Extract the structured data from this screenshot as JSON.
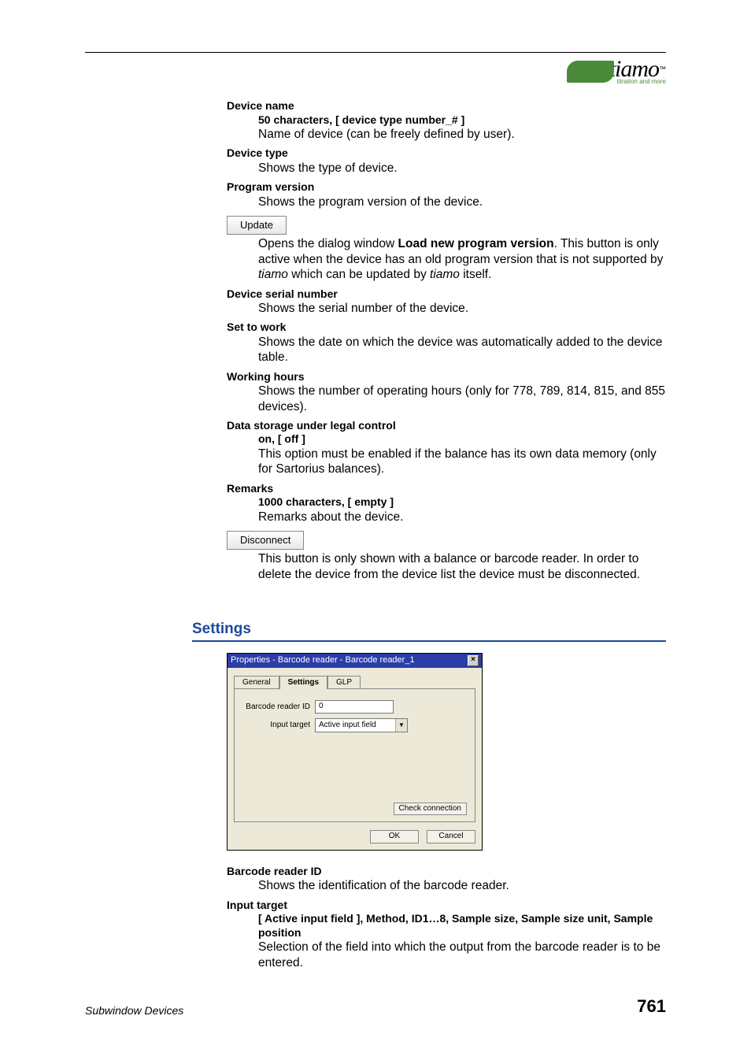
{
  "brand": {
    "name": "tiamo",
    "tm": "™",
    "sub": "titration and more"
  },
  "defs": {
    "device_name": {
      "term": "Device name",
      "sub": "50 characters, [ device type number_# ]",
      "body": "Name of device (can be freely defined by user)."
    },
    "device_type": {
      "term": "Device type",
      "body": "Shows the type of device."
    },
    "program_version": {
      "term": "Program version",
      "body": "Shows the program version of the device."
    },
    "update_btn": "Update",
    "update_body_1": "Opens the dialog window ",
    "update_body_bold": "Load new program version",
    "update_body_2": ". This button is only active when the device has an old program version that is not supported by ",
    "update_body_ital1": "tiamo",
    "update_body_3": " which can be updated by ",
    "update_body_ital2": "tiamo",
    "update_body_4": " itself.",
    "serial": {
      "term": "Device serial number",
      "body": "Shows the serial number of the device."
    },
    "set_to_work": {
      "term": "Set to work",
      "body": "Shows the date on which the device was automatically added to the device table."
    },
    "working_hours": {
      "term": "Working hours",
      "body": "Shows the number of operating hours (only for 778, 789, 814, 815, and 855 devices)."
    },
    "data_storage": {
      "term": "Data storage under legal control",
      "sub": "on, [ off ]",
      "body": "This option must be enabled if the balance has its own data memory (only for Sartorius balances)."
    },
    "remarks": {
      "term": "Remarks",
      "sub": "1000 characters, [ empty ]",
      "body": "Remarks about the device."
    },
    "disconnect_btn": "Disconnect",
    "disconnect_body": "This button is only shown with a balance or barcode reader. In order to delete the device from the device list the device must be disconnected."
  },
  "settings": {
    "heading": "Settings",
    "dialog_title": "Properties - Barcode reader - Barcode reader_1",
    "tab_general": "General",
    "tab_settings": "Settings",
    "tab_glp": "GLP",
    "row_id_label": "Barcode reader ID",
    "row_id_value": "0",
    "row_target_label": "Input target",
    "row_target_value": "Active input field",
    "check_conn": "Check connection",
    "ok": "OK",
    "cancel": "Cancel",
    "defs": {
      "reader_id": {
        "term": "Barcode reader ID",
        "body": "Shows the identification of the barcode reader."
      },
      "input_target": {
        "term": "Input target",
        "sub": "[ Active input field ], Method, ID1…8, Sample size, Sample size unit, Sample position",
        "body": "Selection of the field into which the output from the barcode reader is to be entered."
      }
    }
  },
  "footer": {
    "left": "Subwindow Devices",
    "page": "761"
  }
}
